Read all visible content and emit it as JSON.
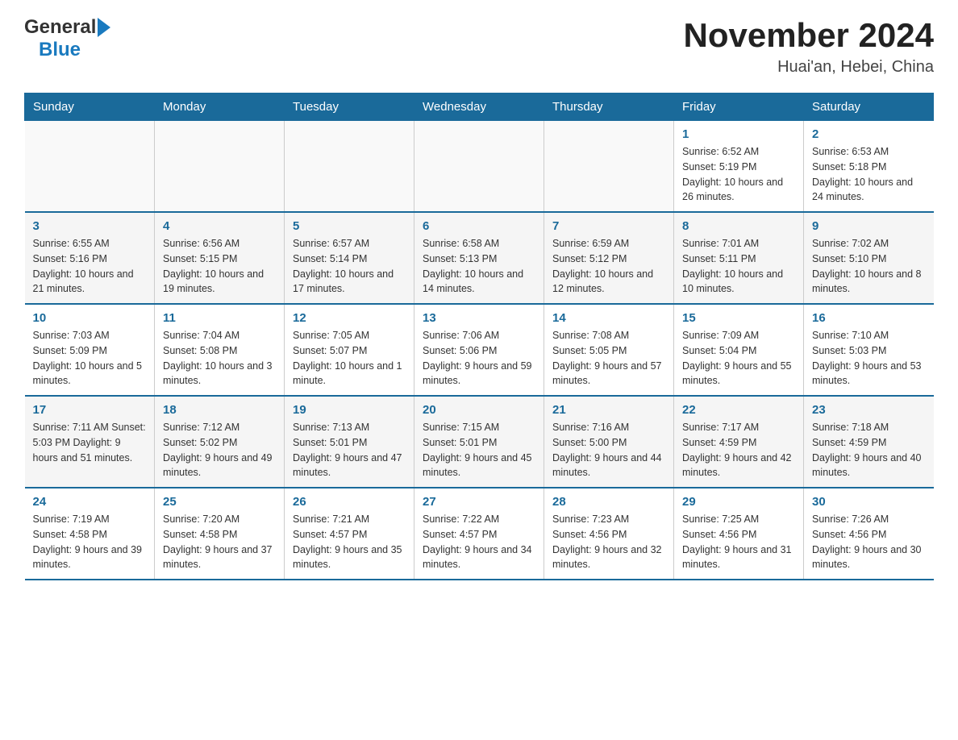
{
  "header": {
    "logo_general": "General",
    "logo_blue": "Blue",
    "title": "November 2024",
    "subtitle": "Huai'an, Hebei, China"
  },
  "days_of_week": [
    "Sunday",
    "Monday",
    "Tuesday",
    "Wednesday",
    "Thursday",
    "Friday",
    "Saturday"
  ],
  "weeks": [
    {
      "days": [
        {
          "number": "",
          "info": ""
        },
        {
          "number": "",
          "info": ""
        },
        {
          "number": "",
          "info": ""
        },
        {
          "number": "",
          "info": ""
        },
        {
          "number": "",
          "info": ""
        },
        {
          "number": "1",
          "info": "Sunrise: 6:52 AM\nSunset: 5:19 PM\nDaylight: 10 hours\nand 26 minutes."
        },
        {
          "number": "2",
          "info": "Sunrise: 6:53 AM\nSunset: 5:18 PM\nDaylight: 10 hours\nand 24 minutes."
        }
      ]
    },
    {
      "days": [
        {
          "number": "3",
          "info": "Sunrise: 6:55 AM\nSunset: 5:16 PM\nDaylight: 10 hours\nand 21 minutes."
        },
        {
          "number": "4",
          "info": "Sunrise: 6:56 AM\nSunset: 5:15 PM\nDaylight: 10 hours\nand 19 minutes."
        },
        {
          "number": "5",
          "info": "Sunrise: 6:57 AM\nSunset: 5:14 PM\nDaylight: 10 hours\nand 17 minutes."
        },
        {
          "number": "6",
          "info": "Sunrise: 6:58 AM\nSunset: 5:13 PM\nDaylight: 10 hours\nand 14 minutes."
        },
        {
          "number": "7",
          "info": "Sunrise: 6:59 AM\nSunset: 5:12 PM\nDaylight: 10 hours\nand 12 minutes."
        },
        {
          "number": "8",
          "info": "Sunrise: 7:01 AM\nSunset: 5:11 PM\nDaylight: 10 hours\nand 10 minutes."
        },
        {
          "number": "9",
          "info": "Sunrise: 7:02 AM\nSunset: 5:10 PM\nDaylight: 10 hours\nand 8 minutes."
        }
      ]
    },
    {
      "days": [
        {
          "number": "10",
          "info": "Sunrise: 7:03 AM\nSunset: 5:09 PM\nDaylight: 10 hours\nand 5 minutes."
        },
        {
          "number": "11",
          "info": "Sunrise: 7:04 AM\nSunset: 5:08 PM\nDaylight: 10 hours\nand 3 minutes."
        },
        {
          "number": "12",
          "info": "Sunrise: 7:05 AM\nSunset: 5:07 PM\nDaylight: 10 hours\nand 1 minute."
        },
        {
          "number": "13",
          "info": "Sunrise: 7:06 AM\nSunset: 5:06 PM\nDaylight: 9 hours\nand 59 minutes."
        },
        {
          "number": "14",
          "info": "Sunrise: 7:08 AM\nSunset: 5:05 PM\nDaylight: 9 hours\nand 57 minutes."
        },
        {
          "number": "15",
          "info": "Sunrise: 7:09 AM\nSunset: 5:04 PM\nDaylight: 9 hours\nand 55 minutes."
        },
        {
          "number": "16",
          "info": "Sunrise: 7:10 AM\nSunset: 5:03 PM\nDaylight: 9 hours\nand 53 minutes."
        }
      ]
    },
    {
      "days": [
        {
          "number": "17",
          "info": "Sunrise: 7:11 AM\nSunset: 5:03 PM\nDaylight: 9 hours\nand 51 minutes."
        },
        {
          "number": "18",
          "info": "Sunrise: 7:12 AM\nSunset: 5:02 PM\nDaylight: 9 hours\nand 49 minutes."
        },
        {
          "number": "19",
          "info": "Sunrise: 7:13 AM\nSunset: 5:01 PM\nDaylight: 9 hours\nand 47 minutes."
        },
        {
          "number": "20",
          "info": "Sunrise: 7:15 AM\nSunset: 5:01 PM\nDaylight: 9 hours\nand 45 minutes."
        },
        {
          "number": "21",
          "info": "Sunrise: 7:16 AM\nSunset: 5:00 PM\nDaylight: 9 hours\nand 44 minutes."
        },
        {
          "number": "22",
          "info": "Sunrise: 7:17 AM\nSunset: 4:59 PM\nDaylight: 9 hours\nand 42 minutes."
        },
        {
          "number": "23",
          "info": "Sunrise: 7:18 AM\nSunset: 4:59 PM\nDaylight: 9 hours\nand 40 minutes."
        }
      ]
    },
    {
      "days": [
        {
          "number": "24",
          "info": "Sunrise: 7:19 AM\nSunset: 4:58 PM\nDaylight: 9 hours\nand 39 minutes."
        },
        {
          "number": "25",
          "info": "Sunrise: 7:20 AM\nSunset: 4:58 PM\nDaylight: 9 hours\nand 37 minutes."
        },
        {
          "number": "26",
          "info": "Sunrise: 7:21 AM\nSunset: 4:57 PM\nDaylight: 9 hours\nand 35 minutes."
        },
        {
          "number": "27",
          "info": "Sunrise: 7:22 AM\nSunset: 4:57 PM\nDaylight: 9 hours\nand 34 minutes."
        },
        {
          "number": "28",
          "info": "Sunrise: 7:23 AM\nSunset: 4:56 PM\nDaylight: 9 hours\nand 32 minutes."
        },
        {
          "number": "29",
          "info": "Sunrise: 7:25 AM\nSunset: 4:56 PM\nDaylight: 9 hours\nand 31 minutes."
        },
        {
          "number": "30",
          "info": "Sunrise: 7:26 AM\nSunset: 4:56 PM\nDaylight: 9 hours\nand 30 minutes."
        }
      ]
    }
  ]
}
